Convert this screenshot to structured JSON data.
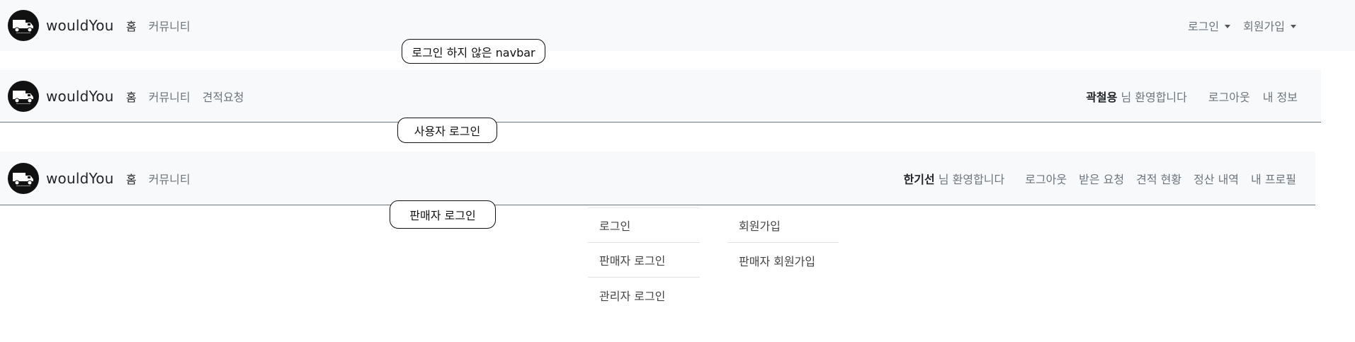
{
  "brand": {
    "name": "wouldYou",
    "logo_icon": "truck-logo-icon"
  },
  "navbar_guest": {
    "left": [
      "홈",
      "커뮤니티"
    ],
    "login_label": "로그인",
    "signup_label": "회원가입"
  },
  "navbar_user": {
    "left": [
      "홈",
      "커뮤니티",
      "견적요청"
    ],
    "username": "곽철용",
    "welcome_suffix": " 님 환영합니다",
    "logout": "로그아웃",
    "my_info": "내 정보"
  },
  "navbar_seller": {
    "left": [
      "홈",
      "커뮤니티"
    ],
    "username": "한기선",
    "welcome_suffix": " 님 환영합니다",
    "items": [
      "로그아웃",
      "받은 요청",
      "견적 현황",
      "정산 내역",
      "내 프로필"
    ]
  },
  "notes": {
    "guest": "로그인 하지 않은 navbar",
    "user": "사용자 로그인",
    "seller": "판매자 로그인"
  },
  "login_dropdown": [
    "로그인",
    "판매자 로그인",
    "관리자 로그인"
  ],
  "signup_dropdown": [
    "회원가입",
    "판매자 회원가입"
  ],
  "colors": {
    "navbar_bg": "#f8f9fa",
    "muted_text": "#6c757d",
    "active_text": "#212529"
  }
}
